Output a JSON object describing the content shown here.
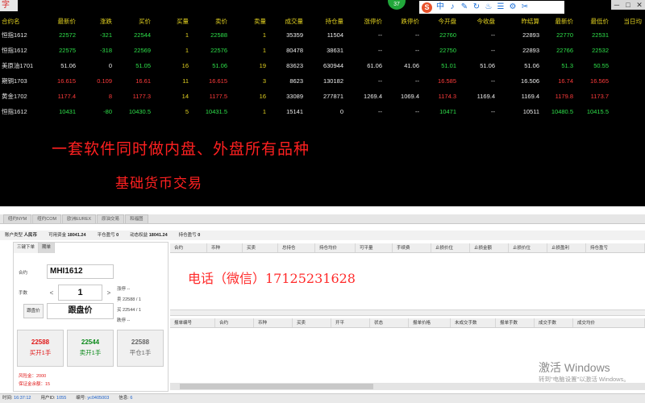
{
  "title_badge": "字",
  "green_badge": "37",
  "window_controls": [
    "─",
    "□",
    "✕"
  ],
  "quote_board": {
    "columns": [
      "合约名",
      "最新价",
      "涨跌",
      "买价",
      "买量",
      "卖价",
      "卖量",
      "成交量",
      "持仓量",
      "涨停价",
      "跌停价",
      "今开盘",
      "今收盘",
      "昨结算",
      "最新价",
      "最低价",
      "当日均"
    ],
    "rows": [
      {
        "name": "恒指1612",
        "cells": [
          "22572",
          "-321",
          "22544",
          "1",
          "22588",
          "1",
          "35359",
          "11504",
          "--",
          "--",
          "22760",
          "--",
          "22893",
          "22770",
          "22531",
          ""
        ]
      },
      {
        "name": "恒指1612",
        "cells": [
          "22575",
          "-318",
          "22569",
          "1",
          "22576",
          "1",
          "80478",
          "38631",
          "--",
          "--",
          "22750",
          "--",
          "22893",
          "22766",
          "22532",
          ""
        ]
      },
      {
        "name": "美原油1701",
        "cells": [
          "51.06",
          "0",
          "51.05",
          "16",
          "51.06",
          "19",
          "83623",
          "630944",
          "61.06",
          "41.06",
          "51.01",
          "51.06",
          "51.06",
          "51.3",
          "50.55",
          ""
        ]
      },
      {
        "name": "期铜1703",
        "cells": [
          "16.615",
          "0.109",
          "16.61",
          "11",
          "16.615",
          "3",
          "8623",
          "130182",
          "--",
          "--",
          "16.585",
          "--",
          "16.506",
          "16.74",
          "16.565",
          ""
        ]
      },
      {
        "name": "黄金1702",
        "cells": [
          "1177.4",
          "8",
          "1177.3",
          "14",
          "1177.5",
          "16",
          "33089",
          "277871",
          "1269.4",
          "1069.4",
          "1174.3",
          "1169.4",
          "1169.4",
          "1179.8",
          "1173.7",
          ""
        ]
      },
      {
        "name": "恒指1612",
        "cells": [
          "10431",
          "-80",
          "10430.5",
          "5",
          "10431.5",
          "1",
          "15141",
          "0",
          "--",
          "--",
          "10471",
          "--",
          "10511",
          "10480.5",
          "10415.5",
          ""
        ]
      }
    ]
  },
  "promo": {
    "line1": "一套软件同时做内盘、外盘所有品种",
    "line2": "基础货币交易",
    "phone": "电话（微信）17125231628"
  },
  "tabs": [
    "纽约NYM",
    "纽约COM",
    "欧洲EUREX",
    "原油交易",
    "和福图"
  ],
  "account_bar": {
    "type_label": "账户类型",
    "type_value": "人民币",
    "available_label": "可用资金",
    "available_value": "18041.24",
    "close_label": "平仓盈亏",
    "close_value": "0",
    "dynamic_label": "动态权益",
    "dynamic_value": "18041.24",
    "hold_label": "持仓盈亏",
    "hold_value": "0"
  },
  "order_panel": {
    "sub_tabs": [
      "三键下单",
      "期单"
    ],
    "contract_label": "合约",
    "contract_value": "MHI1612",
    "qty_label": "手数",
    "qty_value": "1",
    "qty_minus": "<",
    "qty_plus": ">",
    "follow_label": "跟盘价",
    "price_value": "跟盘价",
    "info": {
      "change": "涨停 --",
      "sell": "卖  22588 / 1",
      "buy": "买  22544 / 1",
      "fall": "跌停 --"
    },
    "buttons": {
      "buy_price": "22588",
      "buy_label": "买开1手",
      "sell_price": "22544",
      "sell_label": "卖开1手",
      "close_price": "22588",
      "close_label": "平仓1手"
    },
    "risk_line1": "风险金：2000",
    "risk_line2": "保证金余额：15"
  },
  "positions_header": [
    "合约",
    "币种",
    "买卖",
    "总持仓",
    "持仓均价",
    "可平量",
    "手续费",
    "止损价位",
    "止损金额",
    "止损价位",
    "止损盈利",
    "持仓盈亏"
  ],
  "orders_header": [
    "报单编号",
    "合约",
    "币种",
    "买卖",
    "开平",
    "状态",
    "报单价格",
    "未成交手数",
    "报单手数",
    "成交手数",
    "成交均价"
  ],
  "toolstrip_icons": [
    "S",
    "中",
    "♪",
    "✎",
    "↻",
    "♨",
    "☰",
    "⚙",
    "✂"
  ],
  "watermark": {
    "line1": "激活 Windows",
    "line2": "转到\"电脑设置\"以激活 Windows。"
  },
  "status_bar": {
    "time_label": "时间:",
    "time_value": "16:37:12",
    "user_label": "用户ID:",
    "user_value": "1055",
    "id_label": "编号:",
    "id_value": "yc0405003",
    "info_label": "信息:",
    "info_value": "6"
  }
}
